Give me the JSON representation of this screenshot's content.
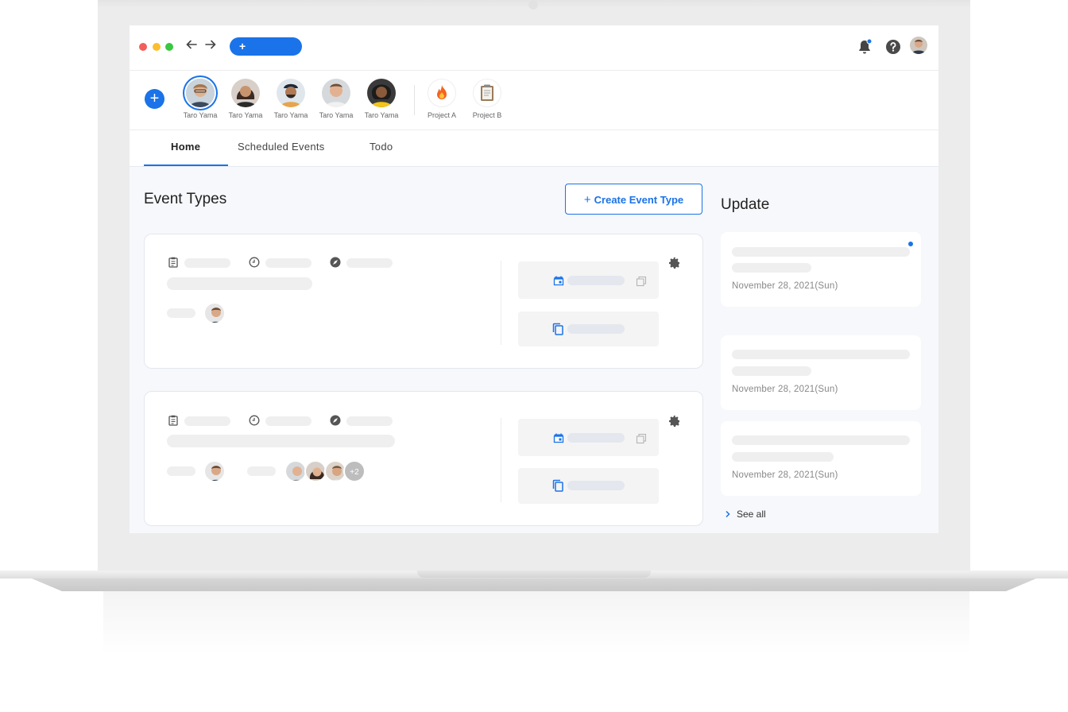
{
  "header": {
    "new_button_label": "+"
  },
  "people": [
    {
      "name": "Taro Yama",
      "selected": true
    },
    {
      "name": "Taro Yama",
      "selected": false
    },
    {
      "name": "Taro Yama",
      "selected": false
    },
    {
      "name": "Taro Yama",
      "selected": false
    },
    {
      "name": "Taro Yama",
      "selected": false
    }
  ],
  "projects": [
    {
      "name": "Project A",
      "icon": "fire-icon"
    },
    {
      "name": "Project B",
      "icon": "clipboard-icon"
    }
  ],
  "tabs": [
    {
      "label": "Home",
      "active": true
    },
    {
      "label": "Scheduled Events",
      "active": false
    },
    {
      "label": "Todo",
      "active": false
    }
  ],
  "main": {
    "title": "Event Types",
    "create_button": "Create Event Type",
    "create_button_icon": "+",
    "extra_count_badge": "+2"
  },
  "updates": {
    "title": "Update",
    "items": [
      {
        "date": "November 28, 2021(Sun)",
        "unread": true
      },
      {
        "date": "November 28, 2021(Sun)",
        "unread": false
      },
      {
        "date": "November 28, 2021(Sun)",
        "unread": false
      }
    ],
    "see_all": "See all"
  },
  "colors": {
    "accent": "#1a73e8",
    "traffic_red": "#f25f58",
    "traffic_yellow": "#fbbe2e",
    "traffic_green": "#39c840"
  }
}
